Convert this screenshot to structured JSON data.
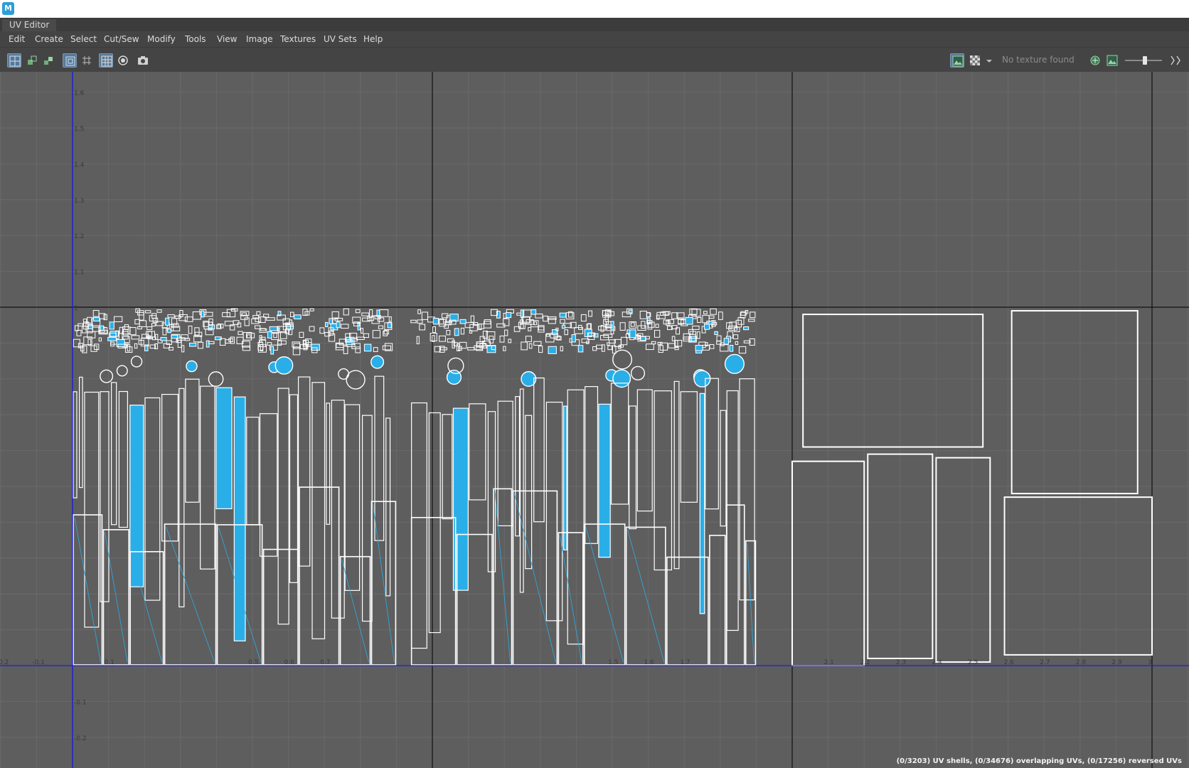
{
  "app": {
    "logo_letter": "M"
  },
  "panel": {
    "tab_label": "UV Editor"
  },
  "menu": [
    "Edit",
    "Create",
    "Select",
    "Cut/Sew",
    "Modify",
    "Tools",
    "View",
    "Image",
    "Textures",
    "UV Sets",
    "Help"
  ],
  "toolbar": {
    "left_icons": [
      "uv-lattice-icon",
      "uv-smudge-icon",
      "uv-layout-icon",
      "grid-display-icon",
      "texture-borders-icon",
      "checker-grid-icon",
      "isolate-select-icon",
      "snapshot-camera-icon"
    ],
    "right_icons": [
      "display-image-icon",
      "checker-tile-icon",
      "dropdown-arrow-icon",
      "exposure-icon",
      "color-management-icon",
      "brightness-slider",
      "gamma-icon"
    ],
    "texture_status": "No texture found"
  },
  "viewport": {
    "v_axis_labels": [
      "1.6",
      "1.5",
      "1.4",
      "1.3",
      "1.2",
      "1.1",
      "1",
      "-0.1",
      "-0.2"
    ],
    "u_axis_labels": [
      "-0.2",
      "-0.1",
      "0.1",
      "0.5",
      "0.6",
      "0.7",
      "1.5",
      "1.6",
      "1.7",
      "2.1",
      "2.2",
      "2.3",
      "2.4",
      "2.5",
      "2.6",
      "2.7",
      "2.8",
      "2.9",
      "3"
    ],
    "colors": {
      "background": "#5e5e5e",
      "grid": "#6a6a6a",
      "udim_border": "#111111",
      "u_axis": "#1a1aff",
      "shell_edge": "#ffffff",
      "selected_fill": "#29aee8"
    }
  },
  "status": {
    "text": "(0/3203) UV shells, (0/34676) overlapping UVs, (0/17256) reversed UVs"
  }
}
